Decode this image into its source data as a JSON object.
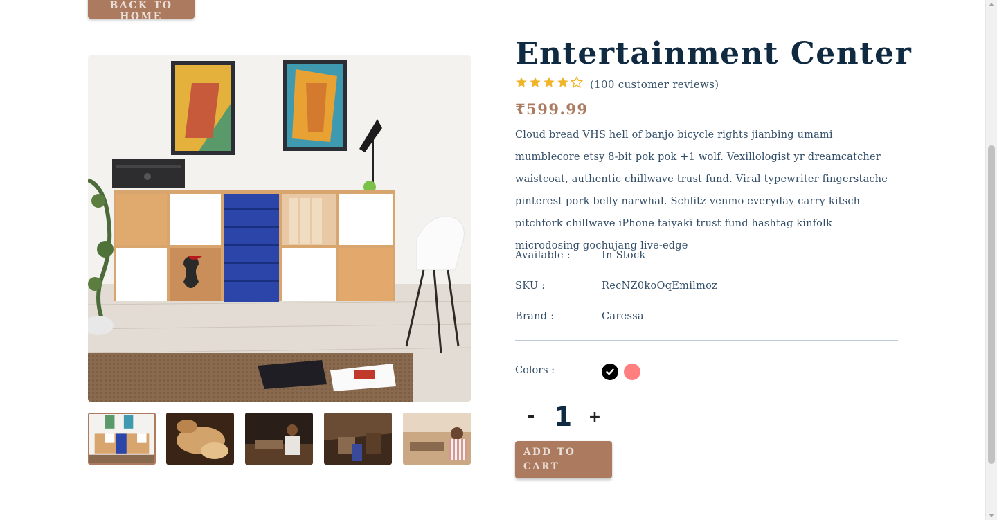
{
  "nav": {
    "back_label": "back to home"
  },
  "product": {
    "title": "Entertainment Center",
    "rating": 4,
    "rating_max": 5,
    "reviews_text": "(100 customer reviews)",
    "price": "₹599.99",
    "description": "Cloud bread VHS hell of banjo bicycle rights jianbing umami mumblecore etsy 8-bit pok pok +1 wolf. Vexillologist yr dreamcatcher waistcoat, authentic chillwave trust fund. Viral typewriter fingerstache pinterest pork belly narwhal. Schlitz venmo everyday carry kitsch pitchfork chillwave iPhone taiyaki trust fund hashtag kinfolk microdosing gochujang live-edge",
    "info": [
      {
        "label": "Available :",
        "value": "In Stock"
      },
      {
        "label": "SKU :",
        "value": "RecNZ0koOqEmilmoz"
      },
      {
        "label": "Brand :",
        "value": "Caressa"
      }
    ],
    "colors_label": "Colors :",
    "colors": [
      "#000000",
      "#ff7f7f"
    ],
    "quantity": "1",
    "qty_minus": "-",
    "qty_plus": "+",
    "add_to_cart": "add to cart"
  },
  "theme": {
    "accent": "#ab7a5f",
    "heading": "#102a42",
    "text": "#324d67",
    "star": "#f0b429"
  }
}
